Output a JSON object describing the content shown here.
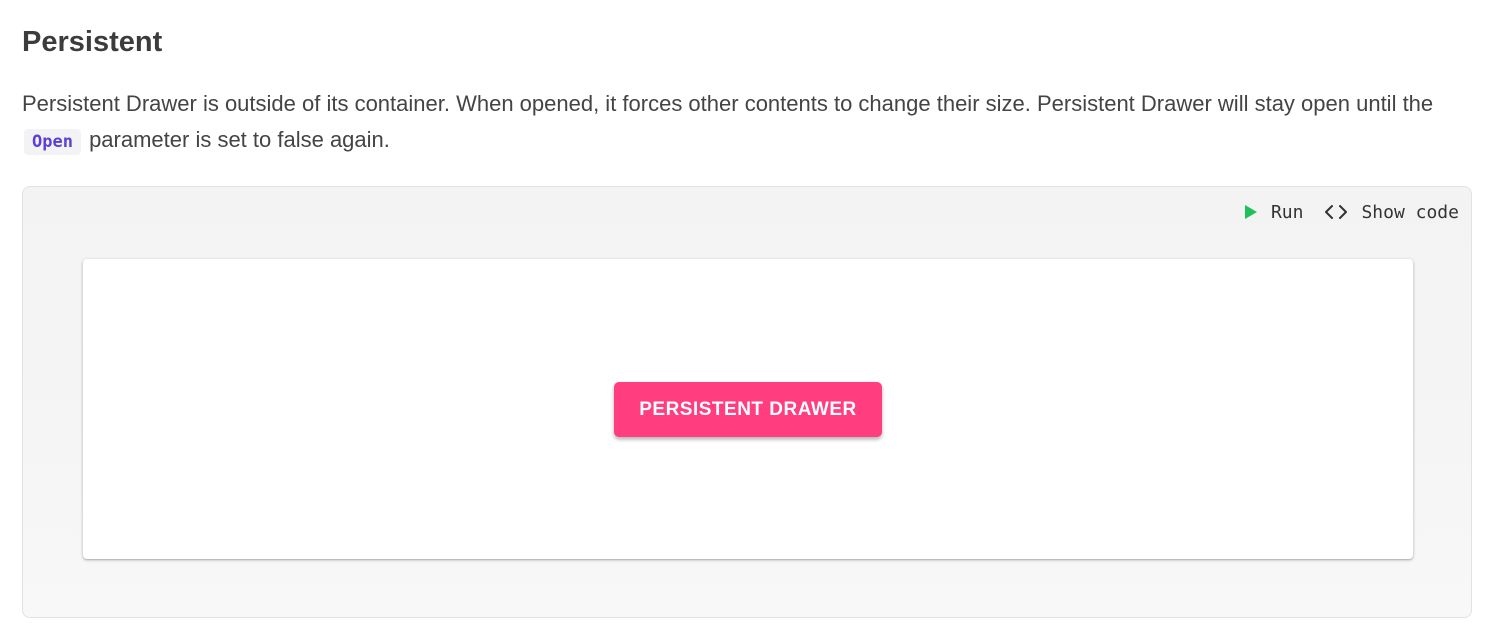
{
  "section": {
    "title": "Persistent",
    "description_before": "Persistent Drawer is outside of its container. When opened, it forces other contents to change their size. Persistent Drawer will stay open until the ",
    "code_term": "Open",
    "description_after": " parameter is set to false again."
  },
  "toolbar": {
    "run_label": "Run",
    "run_icon": "play-icon",
    "show_code_label": "Show code",
    "show_code_icon": "code-brackets-icon",
    "run_icon_color": "#1fbf5a"
  },
  "demo": {
    "button_label": "Persistent Drawer",
    "button_color": "#ff3d7f"
  }
}
